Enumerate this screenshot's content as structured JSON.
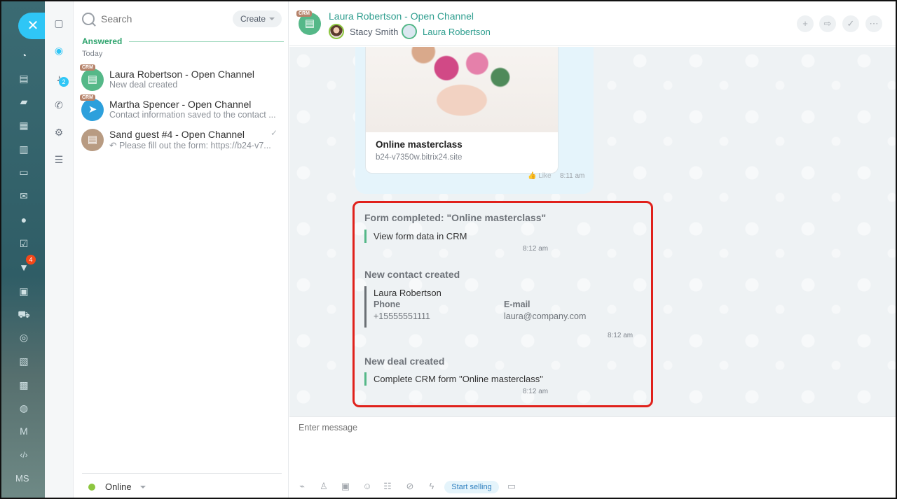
{
  "rail": {
    "close_glyph": "✕",
    "user_initials": "MS",
    "icons": [
      {
        "name": "activity-icon",
        "glyph": "◔"
      },
      {
        "name": "feed-icon",
        "glyph": "▤"
      },
      {
        "name": "chat-icon",
        "glyph": "▰"
      },
      {
        "name": "calendar-icon",
        "glyph": "▦"
      },
      {
        "name": "document-icon",
        "glyph": "▥"
      },
      {
        "name": "drive-icon",
        "glyph": "▭"
      },
      {
        "name": "mail-icon",
        "glyph": "✉"
      },
      {
        "name": "groups-icon",
        "glyph": "●"
      },
      {
        "name": "tasks-icon",
        "glyph": "☑"
      },
      {
        "name": "crm-funnel-icon",
        "glyph": "▼",
        "badge": "4"
      },
      {
        "name": "company-icon",
        "glyph": "▣"
      },
      {
        "name": "shop-icon",
        "glyph": "⛟"
      },
      {
        "name": "target-icon",
        "glyph": "◎"
      },
      {
        "name": "contact-card-icon",
        "glyph": "▧"
      },
      {
        "name": "robot-icon",
        "glyph": "▩"
      },
      {
        "name": "database-icon",
        "glyph": "◍"
      },
      {
        "name": "marketing-icon",
        "glyph": "M"
      },
      {
        "name": "developer-icon",
        "glyph": "‹/›"
      }
    ]
  },
  "tools": {
    "recent_glyph": "▢",
    "openlines_glyph": "◉",
    "notifications_glyph": "♪",
    "notifications_badge": "2",
    "calls_glyph": "✆",
    "settings_glyph": "⚙",
    "crm_glyph": "☰"
  },
  "list": {
    "search_placeholder": "Search",
    "create_label": "Create",
    "group_label": "Answered",
    "date_label": "Today",
    "items": [
      {
        "title": "Laura Robertson - Open Channel",
        "preview": "New deal created",
        "badge": "CRM",
        "color": "#55b888",
        "glyph": "▤"
      },
      {
        "title": "Martha Spencer - Open Channel",
        "preview": "Contact information saved to the contact ...",
        "badge": "CRM",
        "color": "#2da0dc",
        "glyph": "➤"
      },
      {
        "title": "Sand guest #4 - Open Channel",
        "preview": "↶ Please fill out the form: https://b24-v7...",
        "badge": "",
        "color": "#b89b82",
        "glyph": "▤",
        "read": "✓"
      }
    ],
    "status_label": "Online"
  },
  "dialog": {
    "title": "Laura Robertson - Open Channel",
    "crm_badge": "CRM",
    "operator": "Stacy Smith",
    "client": "Laura Robertson",
    "actions": {
      "add": "+",
      "transfer": "⇨",
      "finish": "✓",
      "more": "⋯"
    }
  },
  "card": {
    "title": "Online masterclass",
    "url": "b24-v7350w.bitrix24.site",
    "like_label": "Like",
    "time": "8:11 am"
  },
  "system": {
    "form_title": "Form completed: \"Online masterclass\"",
    "form_link": "View form data in CRM",
    "form_time": "8:12 am",
    "contact_title": "New contact created",
    "contact_name": "Laura Robertson",
    "phone_label": "Phone",
    "phone_value": "+15555551111",
    "email_label": "E-mail",
    "email_value": "laura@company.com",
    "contact_time": "8:12 am",
    "deal_title": "New deal created",
    "deal_text": "Complete CRM form \"Online masterclass\"",
    "deal_time": "8:12 am"
  },
  "composer": {
    "placeholder": "Enter message",
    "start_selling": "Start selling",
    "icons": [
      {
        "name": "attach-icon",
        "glyph": "⌁"
      },
      {
        "name": "user-icon",
        "glyph": "♙"
      },
      {
        "name": "quick-answer-icon",
        "glyph": "▣"
      },
      {
        "name": "smile-icon",
        "glyph": "☺"
      },
      {
        "name": "keyboard-icon",
        "glyph": "☷"
      },
      {
        "name": "hidden-message-icon",
        "glyph": "⊘"
      },
      {
        "name": "lightning-icon",
        "glyph": "ϟ"
      }
    ],
    "chat-icon": "▭"
  }
}
